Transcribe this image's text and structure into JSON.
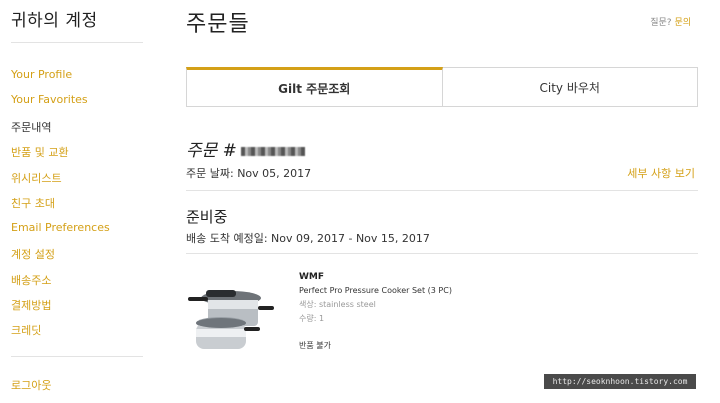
{
  "sidebar": {
    "title": "귀하의 계정",
    "items": [
      {
        "label": "Your Profile"
      },
      {
        "label": "Your Favorites"
      },
      {
        "label": "주문내역"
      },
      {
        "label": "반품 및 교환"
      },
      {
        "label": "위시리스트"
      },
      {
        "label": "친구 초대"
      },
      {
        "label": "Email Preferences"
      },
      {
        "label": "계정 설정"
      },
      {
        "label": "배송주소"
      },
      {
        "label": "결제방법"
      },
      {
        "label": "크레딧"
      }
    ],
    "logout": "로그아웃"
  },
  "header": {
    "title": "주문들",
    "help_prefix": "질문?",
    "help_link": "문의"
  },
  "tabs": [
    {
      "label": "Gilt 주문조회"
    },
    {
      "label": "City 바우처"
    }
  ],
  "order": {
    "number_label": "주문 #",
    "date_label": "주문 날짜:",
    "date_value": "Nov 05, 2017",
    "details_link": "세부 사항 보기",
    "status": "준비중",
    "delivery_label": "배송 도착 예정일:",
    "delivery_value": "Nov 09, 2017 - Nov 15, 2017"
  },
  "product": {
    "brand": "WMF",
    "name": "Perfect Pro Pressure Cooker Set (3 PC)",
    "color": "색상: stainless steel",
    "quantity": "수량: 1",
    "return_note": "반품 불가"
  },
  "watermark": "http://seoknhoon.tistory.com",
  "colors": {
    "accent": "#d4a017",
    "rule": "#e3e3e3",
    "text": "#333333"
  }
}
